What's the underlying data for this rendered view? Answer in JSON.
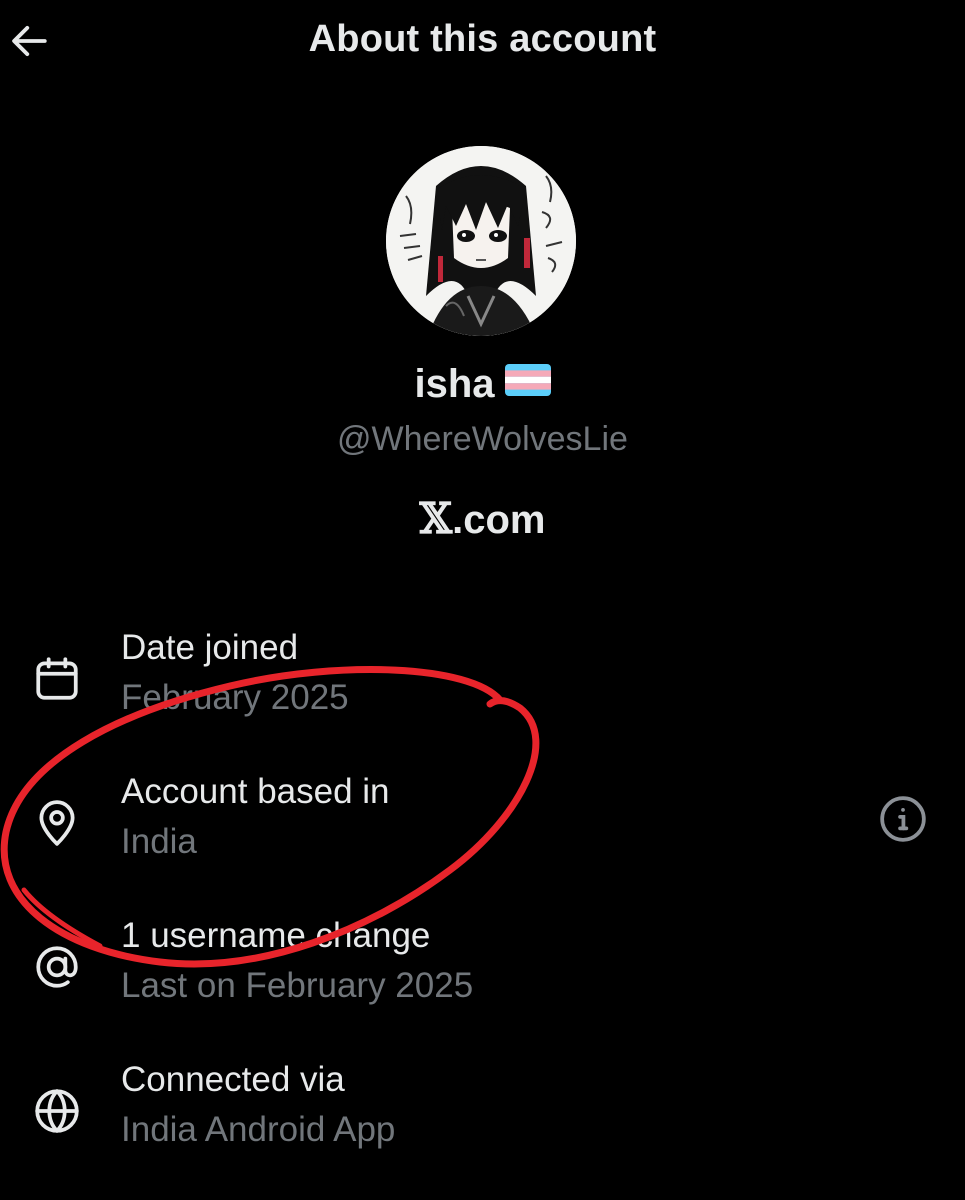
{
  "header": {
    "title": "About this account",
    "back_icon": "arrow-left-icon"
  },
  "profile": {
    "display_name": "isha",
    "flag_icon": "transgender-flag-icon",
    "handle": "@WhereWolvesLie",
    "platform_glyph": "𝕏",
    "platform_suffix": ".com"
  },
  "details": [
    {
      "icon": "calendar-icon",
      "title": "Date joined",
      "value": "February 2025"
    },
    {
      "icon": "location-pin-icon",
      "title": "Account based in",
      "value": "India",
      "action_icon": "info-icon"
    },
    {
      "icon": "at-sign-icon",
      "title": "1 username change",
      "value": "Last on February 2025"
    },
    {
      "icon": "globe-icon",
      "title": "Connected via",
      "value": "India Android App"
    }
  ],
  "colors": {
    "background": "#000000",
    "primary_text": "#e7e9ea",
    "secondary_text": "#71767b",
    "annotation": "#e8242b"
  }
}
